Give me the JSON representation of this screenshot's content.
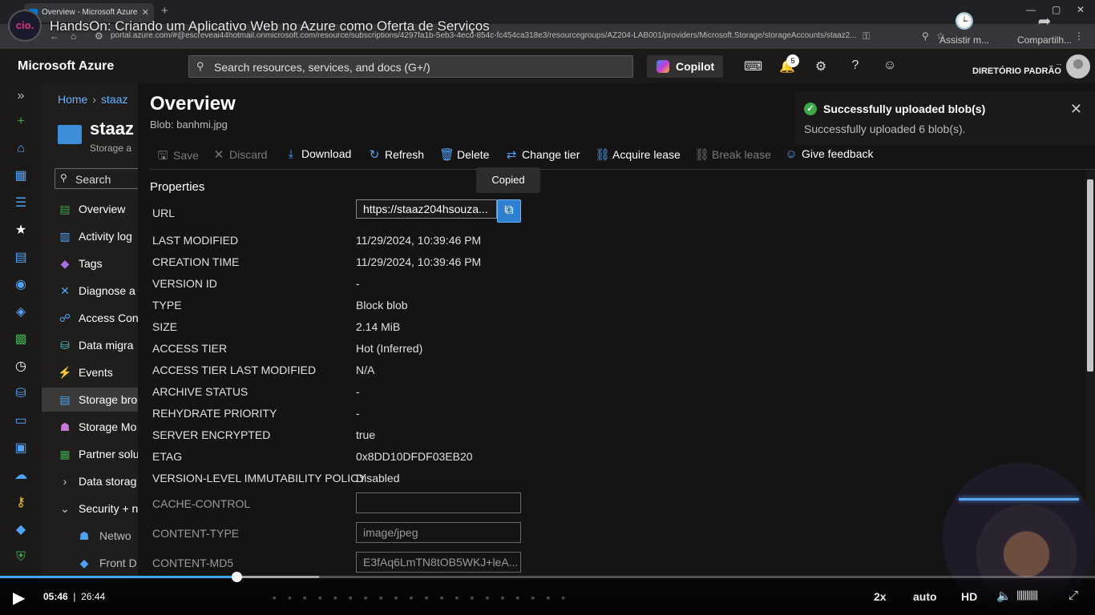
{
  "browser": {
    "tab_title": "Overview - Microsoft Azure",
    "url": "portal.azure.com/#@escreveai44hotmail.onmicrosoft.com/resource/subscriptions/4297fa1b-5eb3-4ecd-854c-fc454ca318e3/resourcegroups/AZ204-LAB001/providers/Microsoft.Storage/storageAccounts/staaz2..."
  },
  "video": {
    "title": "HandsOn: Criando um Aplicativo Web no Azure como Oferta de Serviços",
    "logo_text": "cio.",
    "watch_later": "Assistir m...",
    "share": "Compartilh...",
    "current_time": "05:46",
    "duration": "26:44",
    "progress_fraction": 0.216,
    "speed": "2x",
    "quality": "auto",
    "hd": "HD"
  },
  "azure_top": {
    "brand": "Microsoft Azure",
    "search_placeholder": "Search resources, services, and docs (G+/)",
    "copilot": "Copilot",
    "notifications_count": "5",
    "directory_label": "--",
    "directory": "DIRETÓRIO PADRÃO"
  },
  "resource": {
    "breadcrumb_home": "Home",
    "breadcrumb_current": "staaz",
    "title": "staaz",
    "subtitle": "Storage a",
    "search": "Search",
    "menu": [
      {
        "icon": "overview-icon",
        "label": "Overview"
      },
      {
        "icon": "activity-log-icon",
        "label": "Activity log"
      },
      {
        "icon": "tags-icon",
        "label": "Tags"
      },
      {
        "icon": "diagnose-icon",
        "label": "Diagnose a"
      },
      {
        "icon": "access-control-icon",
        "label": "Access Con"
      },
      {
        "icon": "data-migration-icon",
        "label": "Data migra"
      },
      {
        "icon": "events-icon",
        "label": "Events"
      },
      {
        "icon": "storage-browser-icon",
        "label": "Storage bro"
      },
      {
        "icon": "storage-mover-icon",
        "label": "Storage Mo"
      },
      {
        "icon": "partner-solutions-icon",
        "label": "Partner solu"
      },
      {
        "icon": "chevron-right-icon",
        "label": "Data storag"
      },
      {
        "icon": "chevron-down-icon",
        "label": "Security + n"
      },
      {
        "icon": "networking-icon",
        "label": "Netwo"
      },
      {
        "icon": "front-door-icon",
        "label": "Front D"
      }
    ]
  },
  "blade": {
    "title": "Overview",
    "subtitle": "Blob: banhmi.jpg",
    "commands": {
      "save": "Save",
      "discard": "Discard",
      "download": "Download",
      "refresh": "Refresh",
      "delete": "Delete",
      "change_tier": "Change tier",
      "acquire_lease": "Acquire lease",
      "break_lease": "Break lease",
      "give_feedback": "Give feedback"
    },
    "tooltip": "Copied",
    "section": "Properties",
    "url_label": "URL",
    "url_value": "https://staaz204hsouza...",
    "properties": [
      {
        "label": "LAST MODIFIED",
        "value": "11/29/2024, 10:39:46 PM"
      },
      {
        "label": "CREATION TIME",
        "value": "11/29/2024, 10:39:46 PM"
      },
      {
        "label": "VERSION ID",
        "value": "-"
      },
      {
        "label": "TYPE",
        "value": "Block blob"
      },
      {
        "label": "SIZE",
        "value": "2.14 MiB"
      },
      {
        "label": "ACCESS TIER",
        "value": "Hot (Inferred)"
      },
      {
        "label": "ACCESS TIER LAST MODIFIED",
        "value": "N/A"
      },
      {
        "label": "ARCHIVE STATUS",
        "value": "-"
      },
      {
        "label": "REHYDRATE PRIORITY",
        "value": "-"
      },
      {
        "label": "SERVER ENCRYPTED",
        "value": "true"
      },
      {
        "label": "ETAG",
        "value": "0x8DD10DFDF03EB20"
      },
      {
        "label": "VERSION-LEVEL IMMUTABILITY POLICY",
        "value": "Disabled"
      }
    ],
    "editable": [
      {
        "label": "CACHE-CONTROL",
        "value": ""
      },
      {
        "label": "CONTENT-TYPE",
        "value": "image/jpeg"
      },
      {
        "label": "CONTENT-MD5",
        "value": "E3fAq6LmTN8tOB5WKJ+leA..."
      }
    ]
  },
  "toast": {
    "title": "Successfully uploaded blob(s)",
    "message": "Successfully uploaded 6 blob(s)."
  },
  "colors": {
    "accent": "#4fa3f7",
    "success": "#3aa84b",
    "copy_button": "#2f7fd0"
  }
}
